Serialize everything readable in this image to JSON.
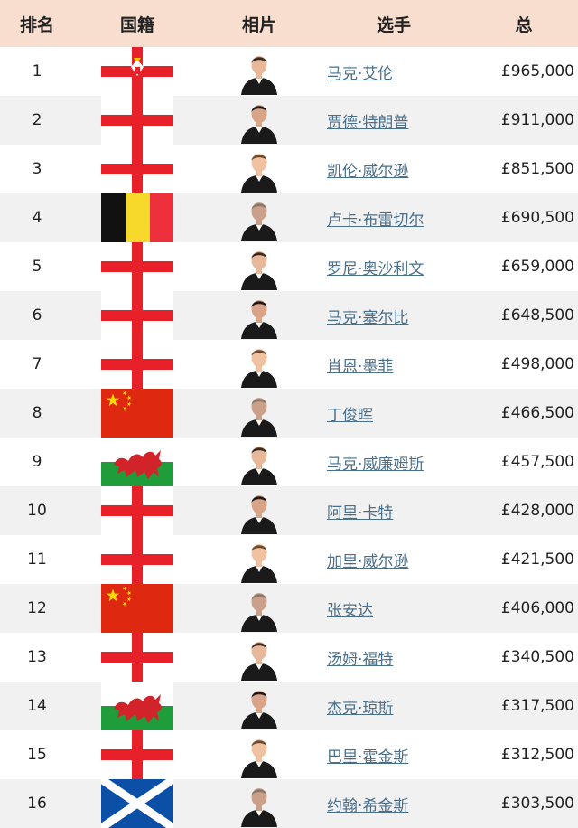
{
  "headers": {
    "rank": "排名",
    "nationality": "国籍",
    "photo": "相片",
    "player": "选手",
    "total": "总"
  },
  "rows": [
    {
      "rank": "1",
      "flag": "northern-ireland-flag-icon",
      "name": "马克·艾伦",
      "prize": "£965,000"
    },
    {
      "rank": "2",
      "flag": "england-flag-icon",
      "name": "贾德·特朗普",
      "prize": "£911,000"
    },
    {
      "rank": "3",
      "flag": "england-flag-icon",
      "name": "凯伦·威尔逊",
      "prize": "£851,500"
    },
    {
      "rank": "4",
      "flag": "belgium-flag-icon",
      "name": "卢卡·布雷切尔",
      "prize": "£690,500"
    },
    {
      "rank": "5",
      "flag": "england-flag-icon",
      "name": "罗尼·奥沙利文",
      "prize": "£659,000"
    },
    {
      "rank": "6",
      "flag": "england-flag-icon",
      "name": "马克·塞尔比",
      "prize": "£648,500"
    },
    {
      "rank": "7",
      "flag": "england-flag-icon",
      "name": "肖恩·墨菲",
      "prize": "£498,000"
    },
    {
      "rank": "8",
      "flag": "china-flag-icon",
      "name": "丁俊晖",
      "prize": "£466,500"
    },
    {
      "rank": "9",
      "flag": "wales-flag-icon",
      "name": "马克·威廉姆斯",
      "prize": "£457,500"
    },
    {
      "rank": "10",
      "flag": "england-flag-icon",
      "name": "阿里·卡特",
      "prize": "£428,000"
    },
    {
      "rank": "11",
      "flag": "england-flag-icon",
      "name": "加里·威尔逊",
      "prize": "£421,500"
    },
    {
      "rank": "12",
      "flag": "china-flag-icon",
      "name": "张安达",
      "prize": "£406,000"
    },
    {
      "rank": "13",
      "flag": "england-flag-icon",
      "name": "汤姆·福特",
      "prize": "£340,500"
    },
    {
      "rank": "14",
      "flag": "wales-flag-icon",
      "name": "杰克·琼斯",
      "prize": "£317,500"
    },
    {
      "rank": "15",
      "flag": "england-flag-icon",
      "name": "巴里·霍金斯",
      "prize": "£312,500"
    },
    {
      "rank": "16",
      "flag": "scotland-flag-icon",
      "name": "约翰·希金斯",
      "prize": "£303,500"
    }
  ],
  "colors": {
    "header_bg": "#f8dece",
    "row_alt_bg": "#f1f1f1",
    "link": "#4a6f8a",
    "england_red": "#e8202a",
    "china_red": "#de2910",
    "china_yellow": "#ffde00",
    "wales_green": "#1f9d3a",
    "scotland_blue": "#0b4fa6",
    "belgium_black": "#111111",
    "belgium_yellow": "#f6d92b",
    "belgium_red": "#ee2f3c"
  }
}
